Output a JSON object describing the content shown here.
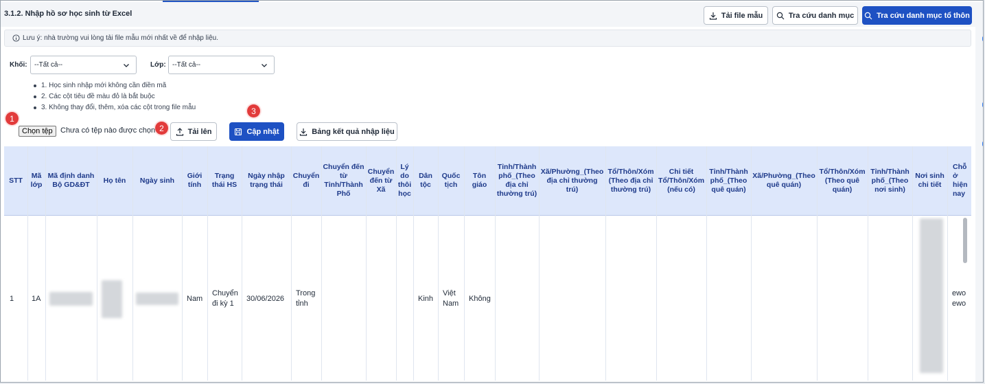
{
  "page": {
    "title": "3.1.2. Nhập hồ sơ học sinh từ Excel",
    "toolbar": {
      "download_template": "Tải file mẫu",
      "lookup_catalog": "Tra cứu danh mục",
      "lookup_org_catalog": "Tra cứu danh mục tổ thôn"
    },
    "note": "Lưu ý: nhà trường vui lòng tải file mẫu mới nhất về để nhập liệu."
  },
  "filters": {
    "grade_label": "Khối:",
    "grade_value": "--Tất cả--",
    "class_label": "Lớp:",
    "class_value": "--Tất cả--"
  },
  "rules": [
    "1. Học sinh nhập mới không cần điền mã",
    "2. Các cột tiêu đề màu đỏ là bắt buộc",
    "3. Không thay đổi, thêm, xóa các cột trong file mẫu"
  ],
  "markers": [
    "1",
    "2",
    "3"
  ],
  "upload": {
    "choose_file": "Chọn tệp",
    "no_file": "Chưa có tệp nào được chọn",
    "upload_label": "Tải lên",
    "update_label": "Cập nhật",
    "result_label": "Bảng kết quả nhập liệu"
  },
  "colors": {
    "primary": "#1e51c3",
    "header_bg": "#dde7fb",
    "marker": "#e23b3b"
  },
  "icons": [
    "info-icon",
    "download-icon",
    "search-icon",
    "chevron-down-icon",
    "upload-icon",
    "save-icon"
  ],
  "table": {
    "columns": [
      "STT",
      "Mã lớp",
      "Mã định danh Bộ GD&ĐT",
      "Họ tên",
      "Ngày sinh",
      "Giới tính",
      "Trạng thái HS",
      "Ngày nhập trạng thái",
      "Chuyển đi",
      "Chuyển đến từ Tỉnh/Thành Phố",
      "Chuyển đến từ Xã",
      "Lý do thôi học",
      "Dân tộc",
      "Quốc tịch",
      "Tôn giáo",
      "Tỉnh/Thành phố_(Theo địa chỉ thường trú)",
      "Xã/Phường_(Theo địa chỉ thường trú)",
      "Tổ/Thôn/Xóm (Theo địa chỉ thường trú)",
      "Chi tiết Tổ/Thôn/Xóm (nếu có)",
      "Tỉnh/Thành phố_(Theo quê quán)",
      "Xã/Phường_(Theo quê quán)",
      "Tổ/Thôn/Xóm (Theo quê quán)",
      "Tỉnh/Thành phố_(Theo nơi sinh)",
      "Nơi sinh chi tiết",
      "Chỗ ở hiện nay"
    ],
    "rows": [
      {
        "stt": "1",
        "class": "1A",
        "gender": "Nam",
        "status": "Chuyển đi kỳ 1",
        "status_date": "30/06/2026",
        "transfer_out": "Trong tỉnh",
        "ethnicity": "Kinh",
        "nationality": "Việt Nam",
        "religion": "Không",
        "current_address": "ewo ewo"
      }
    ]
  }
}
